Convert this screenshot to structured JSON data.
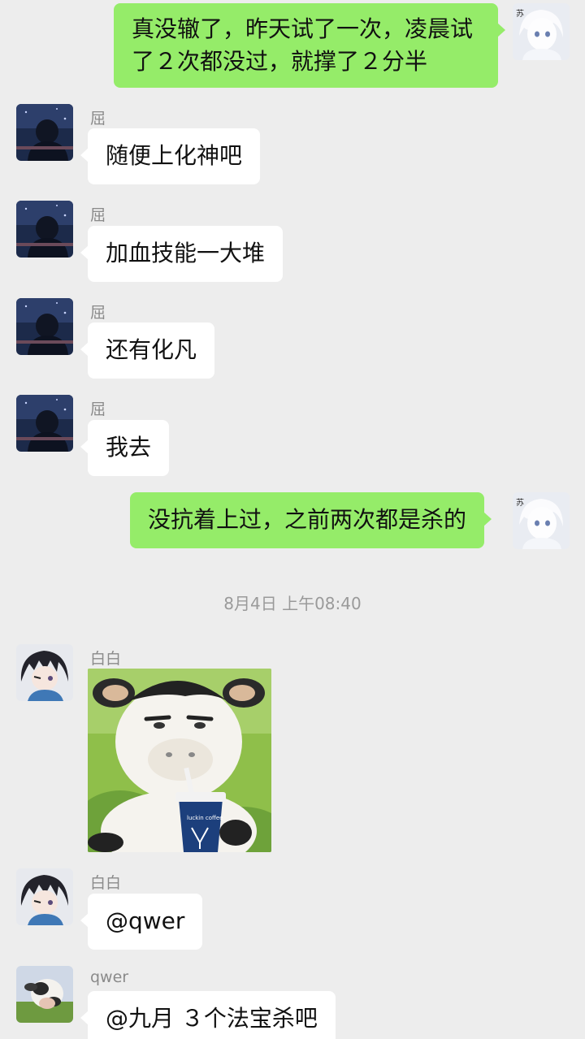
{
  "messages": [
    {
      "sender": "",
      "text": "真没辙了，昨天试了一次，凌晨试了２次都没过，就撑了２分半",
      "side": "right",
      "line1": "真没辙了，昨天试了一次，凌晨试",
      "line2": "了２次都没过，就撑了２分半"
    },
    {
      "sender": "屈",
      "text": "随便上化神吧",
      "side": "left"
    },
    {
      "sender": "屈",
      "text": "加血技能一大堆",
      "side": "left"
    },
    {
      "sender": "屈",
      "text": "还有化凡",
      "side": "left"
    },
    {
      "sender": "屈",
      "text": "我去",
      "side": "left"
    },
    {
      "sender": "",
      "text": "没抗着上过，之前两次都是杀的",
      "side": "right"
    },
    {
      "sender": "白白",
      "type": "sticker",
      "sticker_name": "cow-drinking-coffee-sticker",
      "cup_text": "luckin coffee"
    },
    {
      "sender": "白白",
      "text": "@qwer",
      "side": "left"
    },
    {
      "sender": "qwer",
      "text": "@九月 ３个法宝杀吧",
      "side": "left"
    }
  ],
  "timestamp": "8月4日 上午08:40",
  "self_avatar_text": "苏",
  "colors": {
    "background": "#ededed",
    "bubble_self": "#95ec69",
    "bubble_other": "#ffffff",
    "name_text": "#8a8a8a",
    "timestamp_text": "#9a9a9a"
  }
}
